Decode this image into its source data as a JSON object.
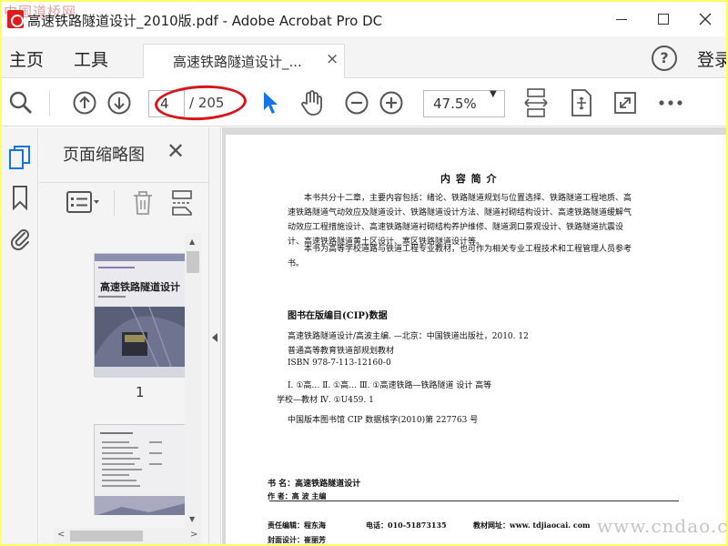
{
  "window": {
    "title": "高速铁路隧道设计_2010版.pdf - Adobe Acrobat Pro DC",
    "watermark_top": "中国道桥网"
  },
  "tabbar": {
    "home_label": "主页",
    "tools_label": "工具",
    "doc_tab_label": "高速铁路隧道设计_...",
    "login_label": "登录"
  },
  "toolbar": {
    "current_page": "4",
    "page_total": "/ 205",
    "zoom_level": "47.5%",
    "accent_color": "#1473e6",
    "annotation_color": "#d8161b"
  },
  "panel": {
    "title": "页面缩略图",
    "thumb1_number": "1",
    "thumb1_title": "高速铁路隧道设计"
  },
  "document": {
    "heading": "内 容 简 介",
    "intro_paragraph": "本书共分十二章，主要内容包括：绪论、铁路隧道规划与位置选择、铁路隧道工程地质、高速铁路隧道气动效应及隧道设计、铁路隧道设计方法、隧道衬砌结构设计、高速铁路隧道缓解气动效应工程措施设计、高速铁路隧道衬砌结构养护维修、隧道洞口景观设计、铁路隧道抗震设计、高速铁路隧道黄土区设计、寒区铁路隧道设计等。",
    "audience_paragraph": "本书为高等学校道路与铁道工程专业教材，也可作为相关专业工程技术和工程管理人员参考书。",
    "cip_heading": "图书在版编目(CIP)数据",
    "cip_line1": "高速铁路隧道设计/高波主编. —北京：中国铁道出版社，2010. 12",
    "cip_line2": "普通高等教育铁道部规划教材",
    "cip_line3": "ISBN 978-7-113-12160-0",
    "cip_line4": "Ⅰ. ①高…   Ⅱ. ①高…   Ⅲ. ①高速铁路—铁路隧道   设计   高等",
    "cip_line5": "学校—教材   Ⅳ. ①U459. 1",
    "cip_line6": "中国版本图书馆 CIP 数据核字(2010)第 227763 号",
    "book_name_label": "书      名：高速铁路隧道设计",
    "author_label": "作      者：高   波   主编",
    "editor_label": "责任编辑：程东海",
    "phone_label": "电话：010-51873135",
    "website_label": "教材网址：www. tdjiaocai. com",
    "cover_label": "封面设计：崔丽芳"
  },
  "watermark_bottom": "www.cndao.com"
}
